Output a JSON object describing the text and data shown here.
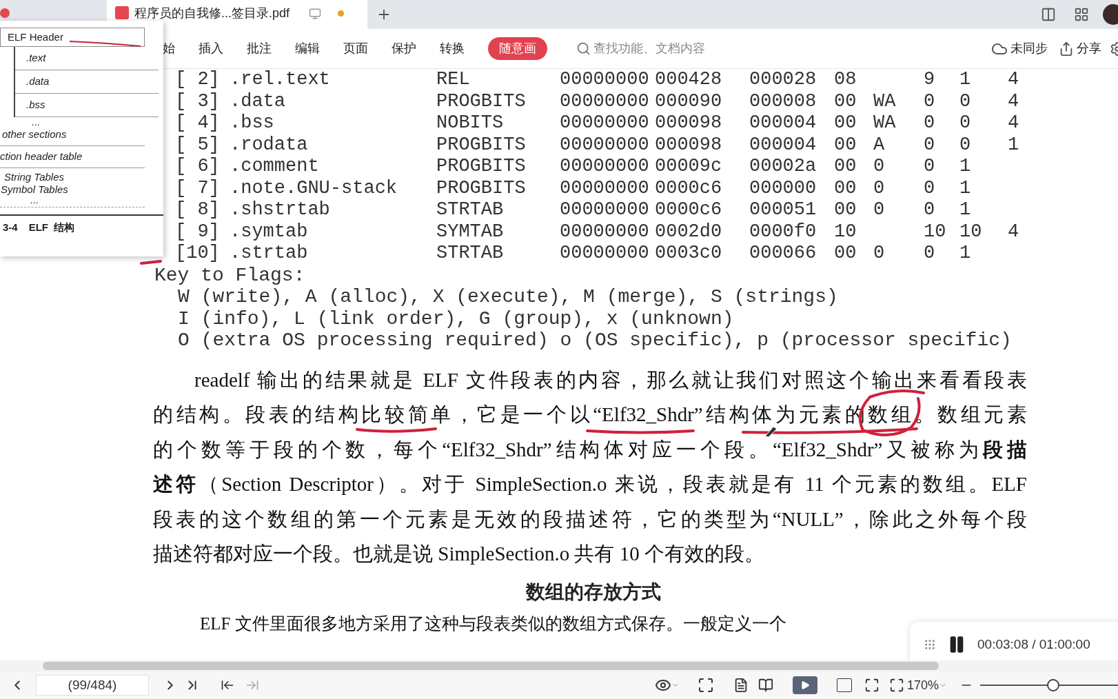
{
  "tabs": [
    {
      "selected": false,
      "kind": "doc"
    },
    {
      "label": "程序员的自我修...签目录.pdf",
      "selected": true,
      "kind": "pdf"
    }
  ],
  "menu": [
    {
      "label": "始",
      "selected": false
    },
    {
      "label": "插入",
      "selected": false
    },
    {
      "label": "批注",
      "selected": false
    },
    {
      "label": "编辑",
      "selected": false
    },
    {
      "label": "页面",
      "selected": false
    },
    {
      "label": "保护",
      "selected": false
    },
    {
      "label": "转换",
      "selected": false
    },
    {
      "label": "随意画",
      "selected": true
    }
  ],
  "search": {
    "placeholder": "查找功能、文档内容"
  },
  "toolbar_right": [
    "未同步",
    "分享"
  ],
  "table_rows": [
    {
      "index": "[ 2]",
      "name": ".rel.text",
      "type": "REL",
      "addr": "00000000",
      "off": "000428",
      "size": "000028",
      "es": "08",
      "lk": "9",
      "inf": "1",
      "al": "4"
    },
    {
      "index": "[ 3]",
      "name": ".data",
      "type": "PROGBITS",
      "addr": "00000000",
      "off": "000090",
      "size": "000008",
      "es": "00",
      "flg": "WA",
      "lk": "0",
      "inf": "0",
      "al": "4"
    },
    {
      "index": "[ 4]",
      "name": ".bss",
      "type": "NOBITS",
      "addr": "00000000",
      "off": "000098",
      "size": "000004",
      "es": "00",
      "flg": "WA",
      "lk": "0",
      "inf": "0",
      "al": "4"
    },
    {
      "index": "[ 5]",
      "name": ".rodata",
      "type": "PROGBITS",
      "addr": "00000000",
      "off": "000098",
      "size": "000004",
      "es": "00",
      "flg": "A",
      "lk": "0",
      "inf": "0",
      "al": "1"
    },
    {
      "index": "[ 6]",
      "name": ".comment",
      "type": "PROGBITS",
      "addr": "00000000",
      "off": "00009c",
      "size": "00002a",
      "es": "00",
      "flg": "0",
      "lk": "0",
      "inf": "1"
    },
    {
      "index": "[ 7]",
      "name": ".note.GNU-stack",
      "type": "PROGBITS",
      "addr": "00000000",
      "off": "0000c6",
      "size": "000000",
      "es": "00",
      "flg": "0",
      "lk": "0",
      "inf": "1"
    },
    {
      "index": "[ 8]",
      "name": ".shstrtab",
      "type": "STRTAB",
      "addr": "00000000",
      "off": "0000c6",
      "size": "000051",
      "es": "00",
      "flg": "0",
      "lk": "0",
      "inf": "1"
    },
    {
      "index": "[ 9]",
      "name": ".symtab",
      "type": "SYMTAB",
      "addr": "00000000",
      "off": "0002d0",
      "size": "0000f0",
      "es": "10",
      "lk": "10",
      "inf": "10",
      "al": "4"
    },
    {
      "index": "[10]",
      "name": ".strtab",
      "type": "STRTAB",
      "addr": "00000000",
      "off": "0003c0",
      "size": "000066",
      "es": "00",
      "flg": "0",
      "lk": "0",
      "inf": "1"
    }
  ],
  "flags": {
    "title": "Key to Flags:",
    "lines": [
      "W (write), A (alloc), X (execute), M (merge), S (strings)",
      "I (info), L (link order), G (group), x (unknown)",
      "O (extra OS processing required) o (OS specific), p (processor specific)"
    ]
  },
  "paragraph": [
    "readelf 输出的结果就是 ELF 文件段表的内容，那么就让我们对照这个输出来看看段表",
    "的结构。段表的结构比较简单，它是一个以“Elf32_Shdr”结构体为元素的数组。数组元素",
    "的个数等于段的个数，每个“Elf32_Shdr”结构体对应一个段。“Elf32_Shdr”又被称为**段描**",
    "**述符**（Section Descriptor）。对于 SimpleSection.o 来说，段表就是有 11 个元素的数组。ELF",
    "段表的这个数组的第一个元素是无效的段描述符，它的类型为“NULL”，除此之外每个段",
    "描述符都对应一个段。也就是说 SimpleSection.o 共有 10 个有效的段。"
  ],
  "heading": "数组的存放方式",
  "next_line": "ELF 文件里面很多地方采用了这种与段表类似的数组方式保存。一般定义一个",
  "figure": {
    "header": "ELF Header",
    "sections": [
      ".text",
      ".data",
      ".bss"
    ],
    "ellipsis": "...",
    "other": "other sections",
    "table": "ction header table",
    "tables": [
      "String Tables",
      "Symbol Tables"
    ],
    "ellipsis2": "...",
    "caption_number": "3-4",
    "caption": "ELF  结构"
  },
  "timer": {
    "time": "00:03:08 / 01:00:00"
  },
  "status": {
    "page": "(99/484)",
    "zoom": "170%",
    "zoom_slider": {
      "level": 0.53
    }
  }
}
